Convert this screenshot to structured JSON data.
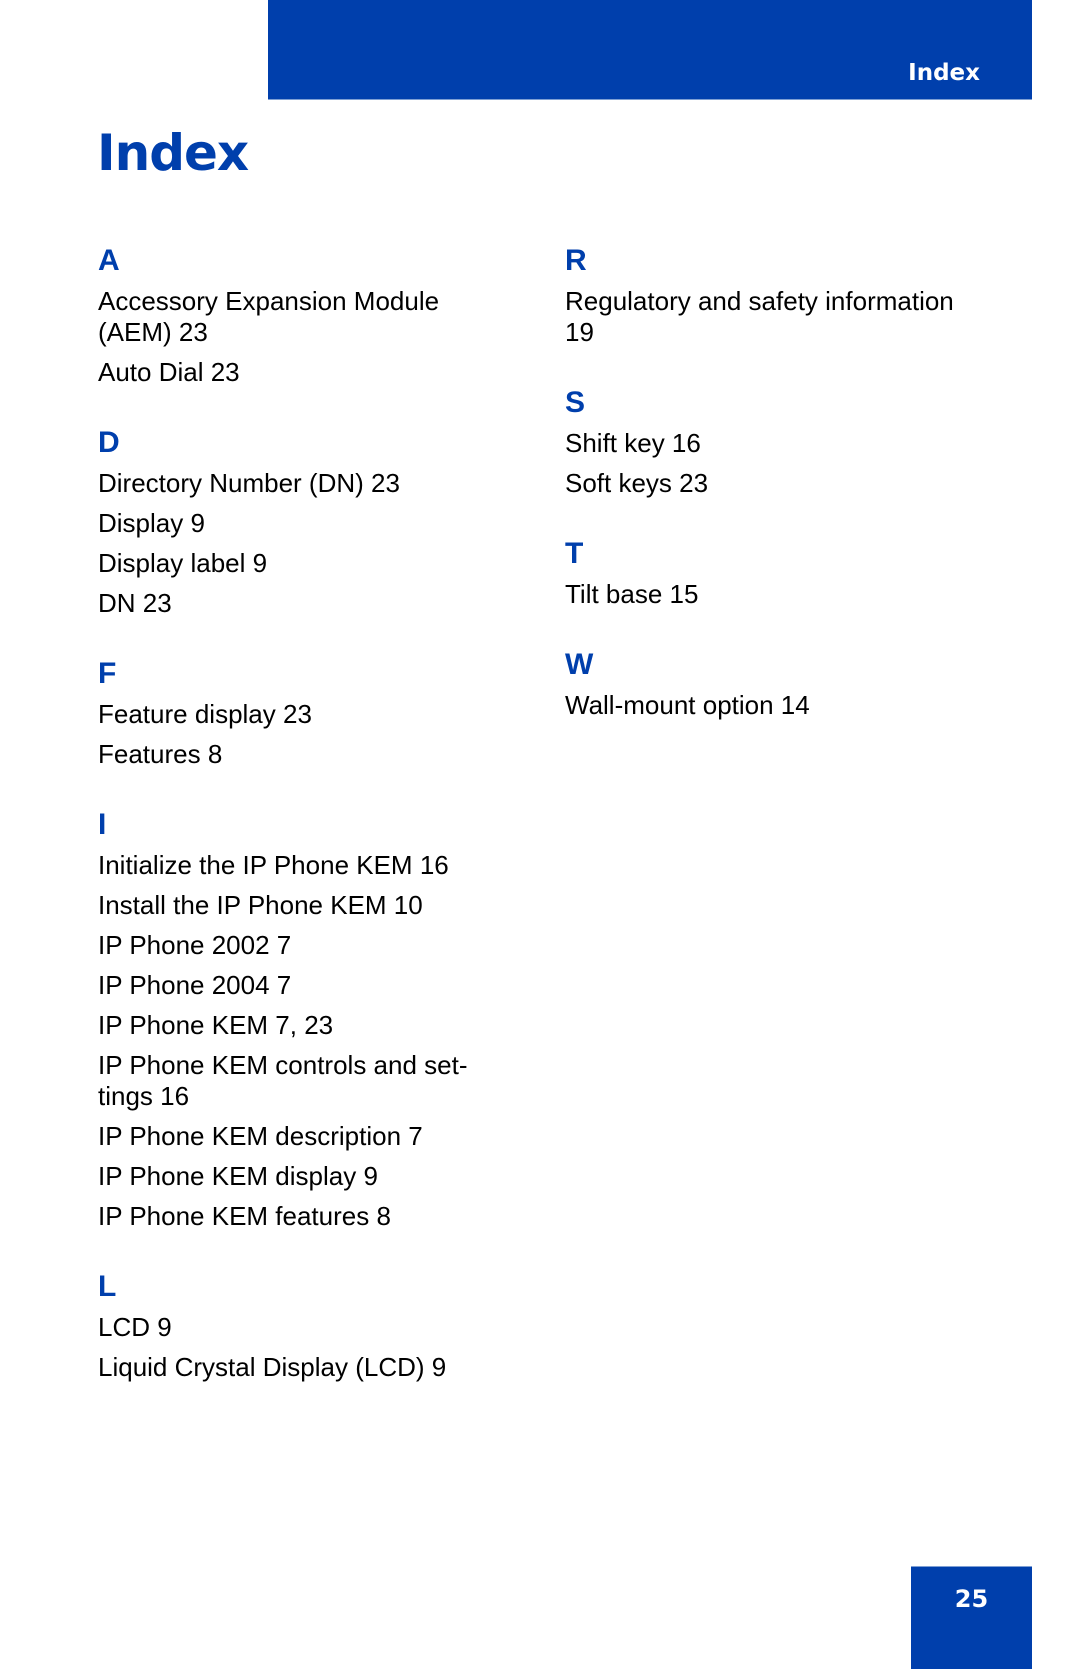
{
  "header": {
    "section_label": "Index",
    "accent_color": "#003fac"
  },
  "page_title": "Index",
  "columns": [
    {
      "sections": [
        {
          "letter": "A",
          "entries": [
            "Accessory Expansion Module (AEM) 23",
            "Auto Dial 23"
          ]
        },
        {
          "letter": "D",
          "entries": [
            "Directory Number (DN) 23",
            "Display 9",
            "Display label 9",
            "DN 23"
          ]
        },
        {
          "letter": "F",
          "entries": [
            "Feature display 23",
            "Features 8"
          ]
        },
        {
          "letter": "I",
          "entries": [
            "Initialize the IP Phone KEM 16",
            "Install the IP Phone KEM 10",
            "IP Phone 2002 7",
            "IP Phone 2004 7",
            "IP Phone KEM 7, 23",
            "IP Phone KEM controls and set-\ntings 16",
            "IP Phone KEM description 7",
            "IP Phone KEM display 9",
            "IP Phone KEM features 8"
          ]
        },
        {
          "letter": "L",
          "entries": [
            "LCD 9",
            "Liquid Crystal Display (LCD) 9"
          ]
        }
      ]
    },
    {
      "sections": [
        {
          "letter": "R",
          "entries": [
            "Regulatory and safety information\n19"
          ]
        },
        {
          "letter": "S",
          "entries": [
            "Shift key 16",
            "Soft keys 23"
          ]
        },
        {
          "letter": "T",
          "entries": [
            "Tilt base 15"
          ]
        },
        {
          "letter": "W",
          "entries": [
            "Wall-mount option 14"
          ]
        }
      ]
    }
  ],
  "footer": {
    "page_number": "25"
  }
}
